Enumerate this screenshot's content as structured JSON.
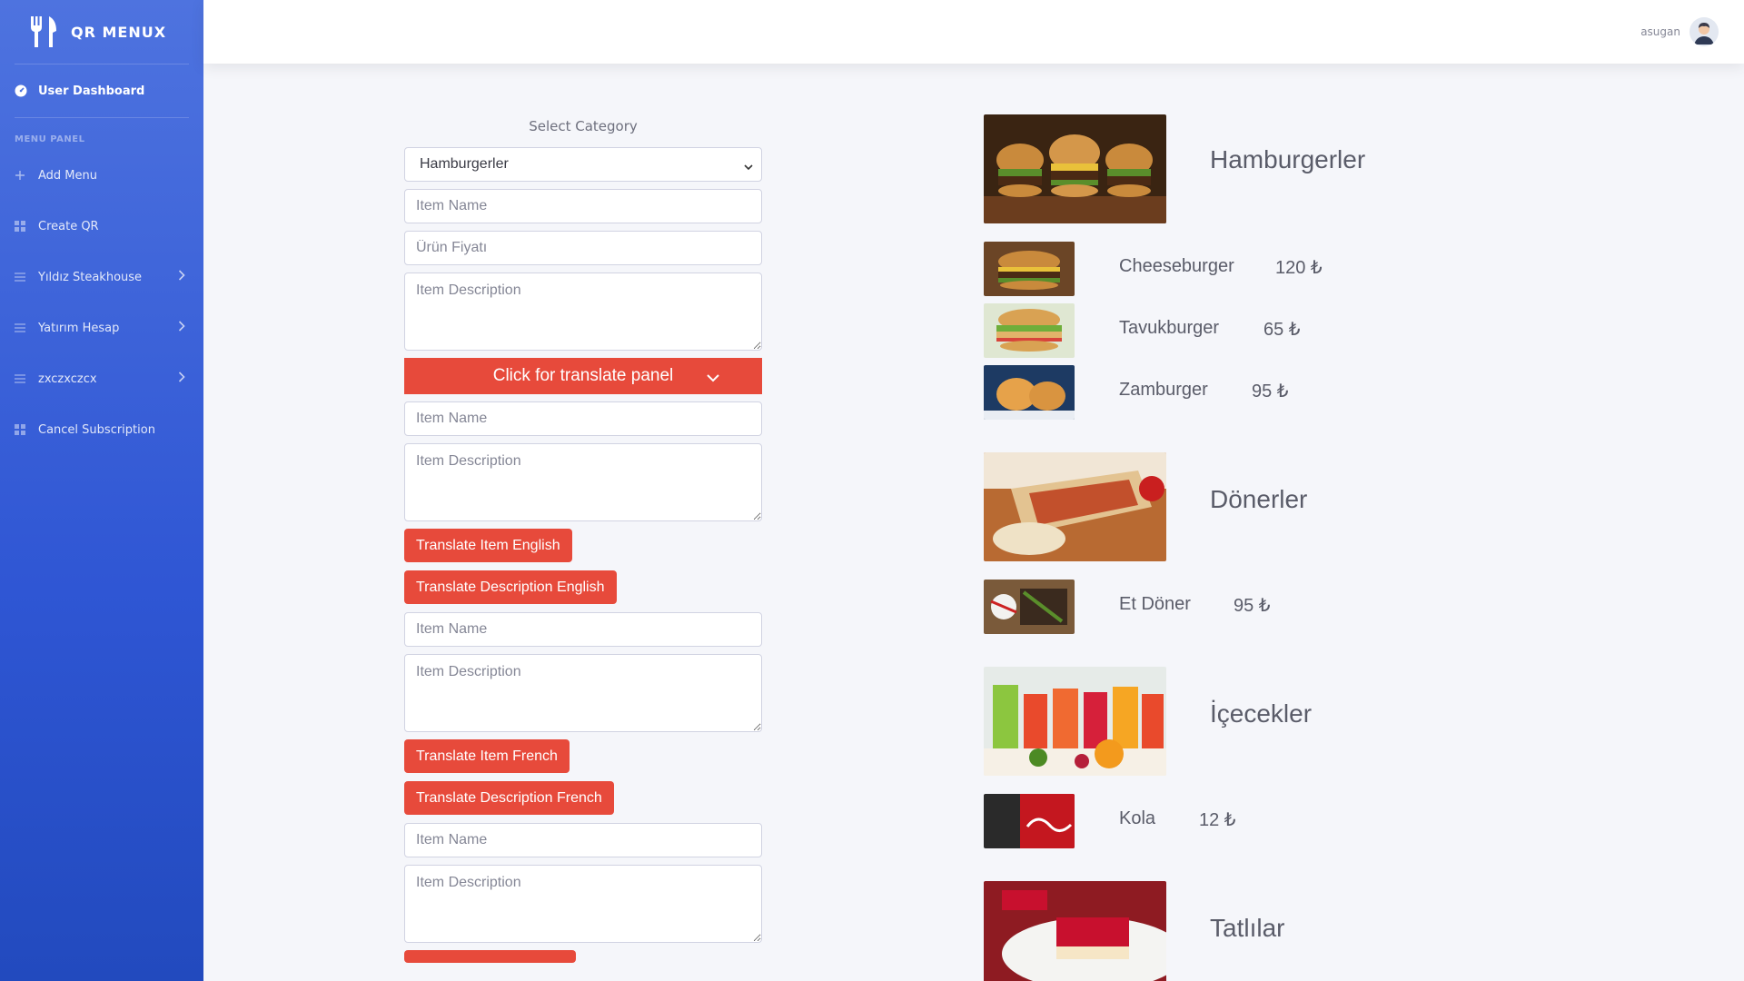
{
  "app": {
    "brand": "QR MENUX"
  },
  "sidebar": {
    "dashboard": "User Dashboard",
    "heading": "MENU PANEL",
    "items": [
      {
        "label": "Add Menu",
        "icon": "plus-icon",
        "has_arrow": false
      },
      {
        "label": "Create QR",
        "icon": "grid-icon",
        "has_arrow": false
      },
      {
        "label": "Yıldız Steakhouse",
        "icon": "list-icon",
        "has_arrow": true
      },
      {
        "label": "Yatırım Hesap",
        "icon": "list-icon",
        "has_arrow": true
      },
      {
        "label": "zxczxczcx",
        "icon": "list-icon",
        "has_arrow": true
      },
      {
        "label": "Cancel Subscription",
        "icon": "grid-icon",
        "has_arrow": false
      }
    ]
  },
  "topbar": {
    "username": "asugan"
  },
  "form": {
    "select_label": "Select Category",
    "category_selected": "Hamburgerler",
    "item_name_placeholder": "Item Name",
    "price_placeholder": "Ürün Fiyatı",
    "description_placeholder": "Item Description",
    "translate_panel_label": "Click for translate panel",
    "btn_translate_item_en": "Translate Item English",
    "btn_translate_desc_en": "Translate Description English",
    "btn_translate_item_fr": "Translate Item French",
    "btn_translate_desc_fr": "Translate Description French"
  },
  "menu": {
    "categories": [
      {
        "title": "Hamburgerler",
        "items": [
          {
            "name": "Cheeseburger",
            "price": "120 ₺"
          },
          {
            "name": "Tavukburger",
            "price": "65 ₺"
          },
          {
            "name": "Zamburger",
            "price": "95 ₺"
          }
        ]
      },
      {
        "title": "Dönerler",
        "items": [
          {
            "name": "Et Döner",
            "price": "95 ₺"
          }
        ]
      },
      {
        "title": "İçecekler",
        "items": [
          {
            "name": "Kola",
            "price": "12 ₺"
          }
        ]
      },
      {
        "title": "Tatlılar",
        "items": []
      }
    ]
  },
  "colors": {
    "sidebar": "#4e73df",
    "accent_red": "#e74a3b",
    "text": "#5a5c69"
  }
}
